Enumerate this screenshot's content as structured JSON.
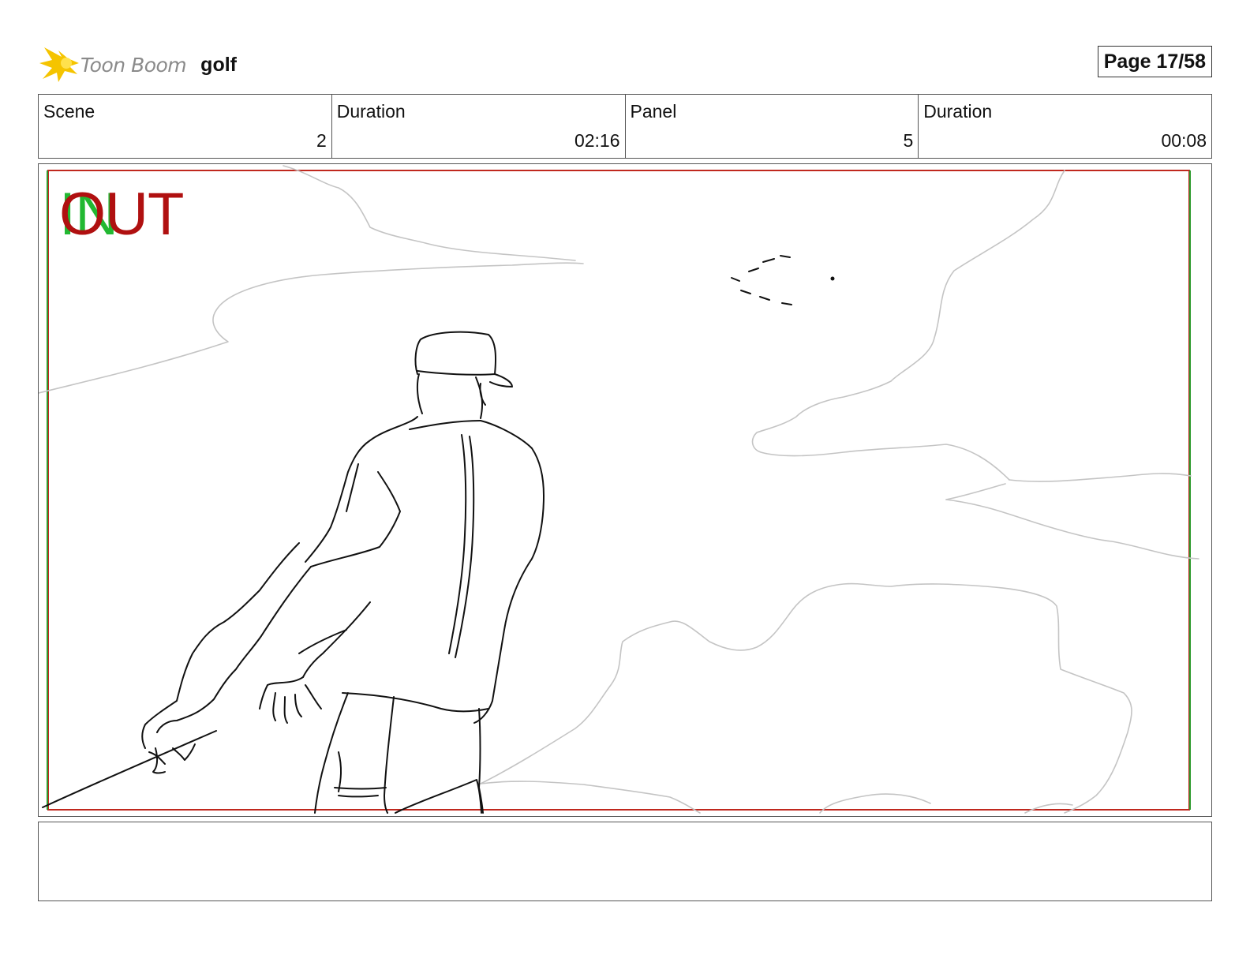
{
  "header": {
    "logo_text": "Toon Boom",
    "project_name": "golf",
    "page_label": "Page 17/58"
  },
  "info": {
    "scene_label": "Scene",
    "scene_value": "2",
    "scene_duration_label": "Duration",
    "scene_duration_value": "02:16",
    "panel_label": "Panel",
    "panel_value": "5",
    "panel_duration_label": "Duration",
    "panel_duration_value": "00:08"
  },
  "panel": {
    "in_marker": "IN",
    "out_marker": "OUT"
  },
  "notes": {
    "text": ""
  },
  "colors": {
    "safe_frame_red": "#c0281e",
    "safe_frame_green": "#2c9a2c",
    "logo_yellow": "#f5c400",
    "logo_text_gray": "#8a8a8a"
  }
}
